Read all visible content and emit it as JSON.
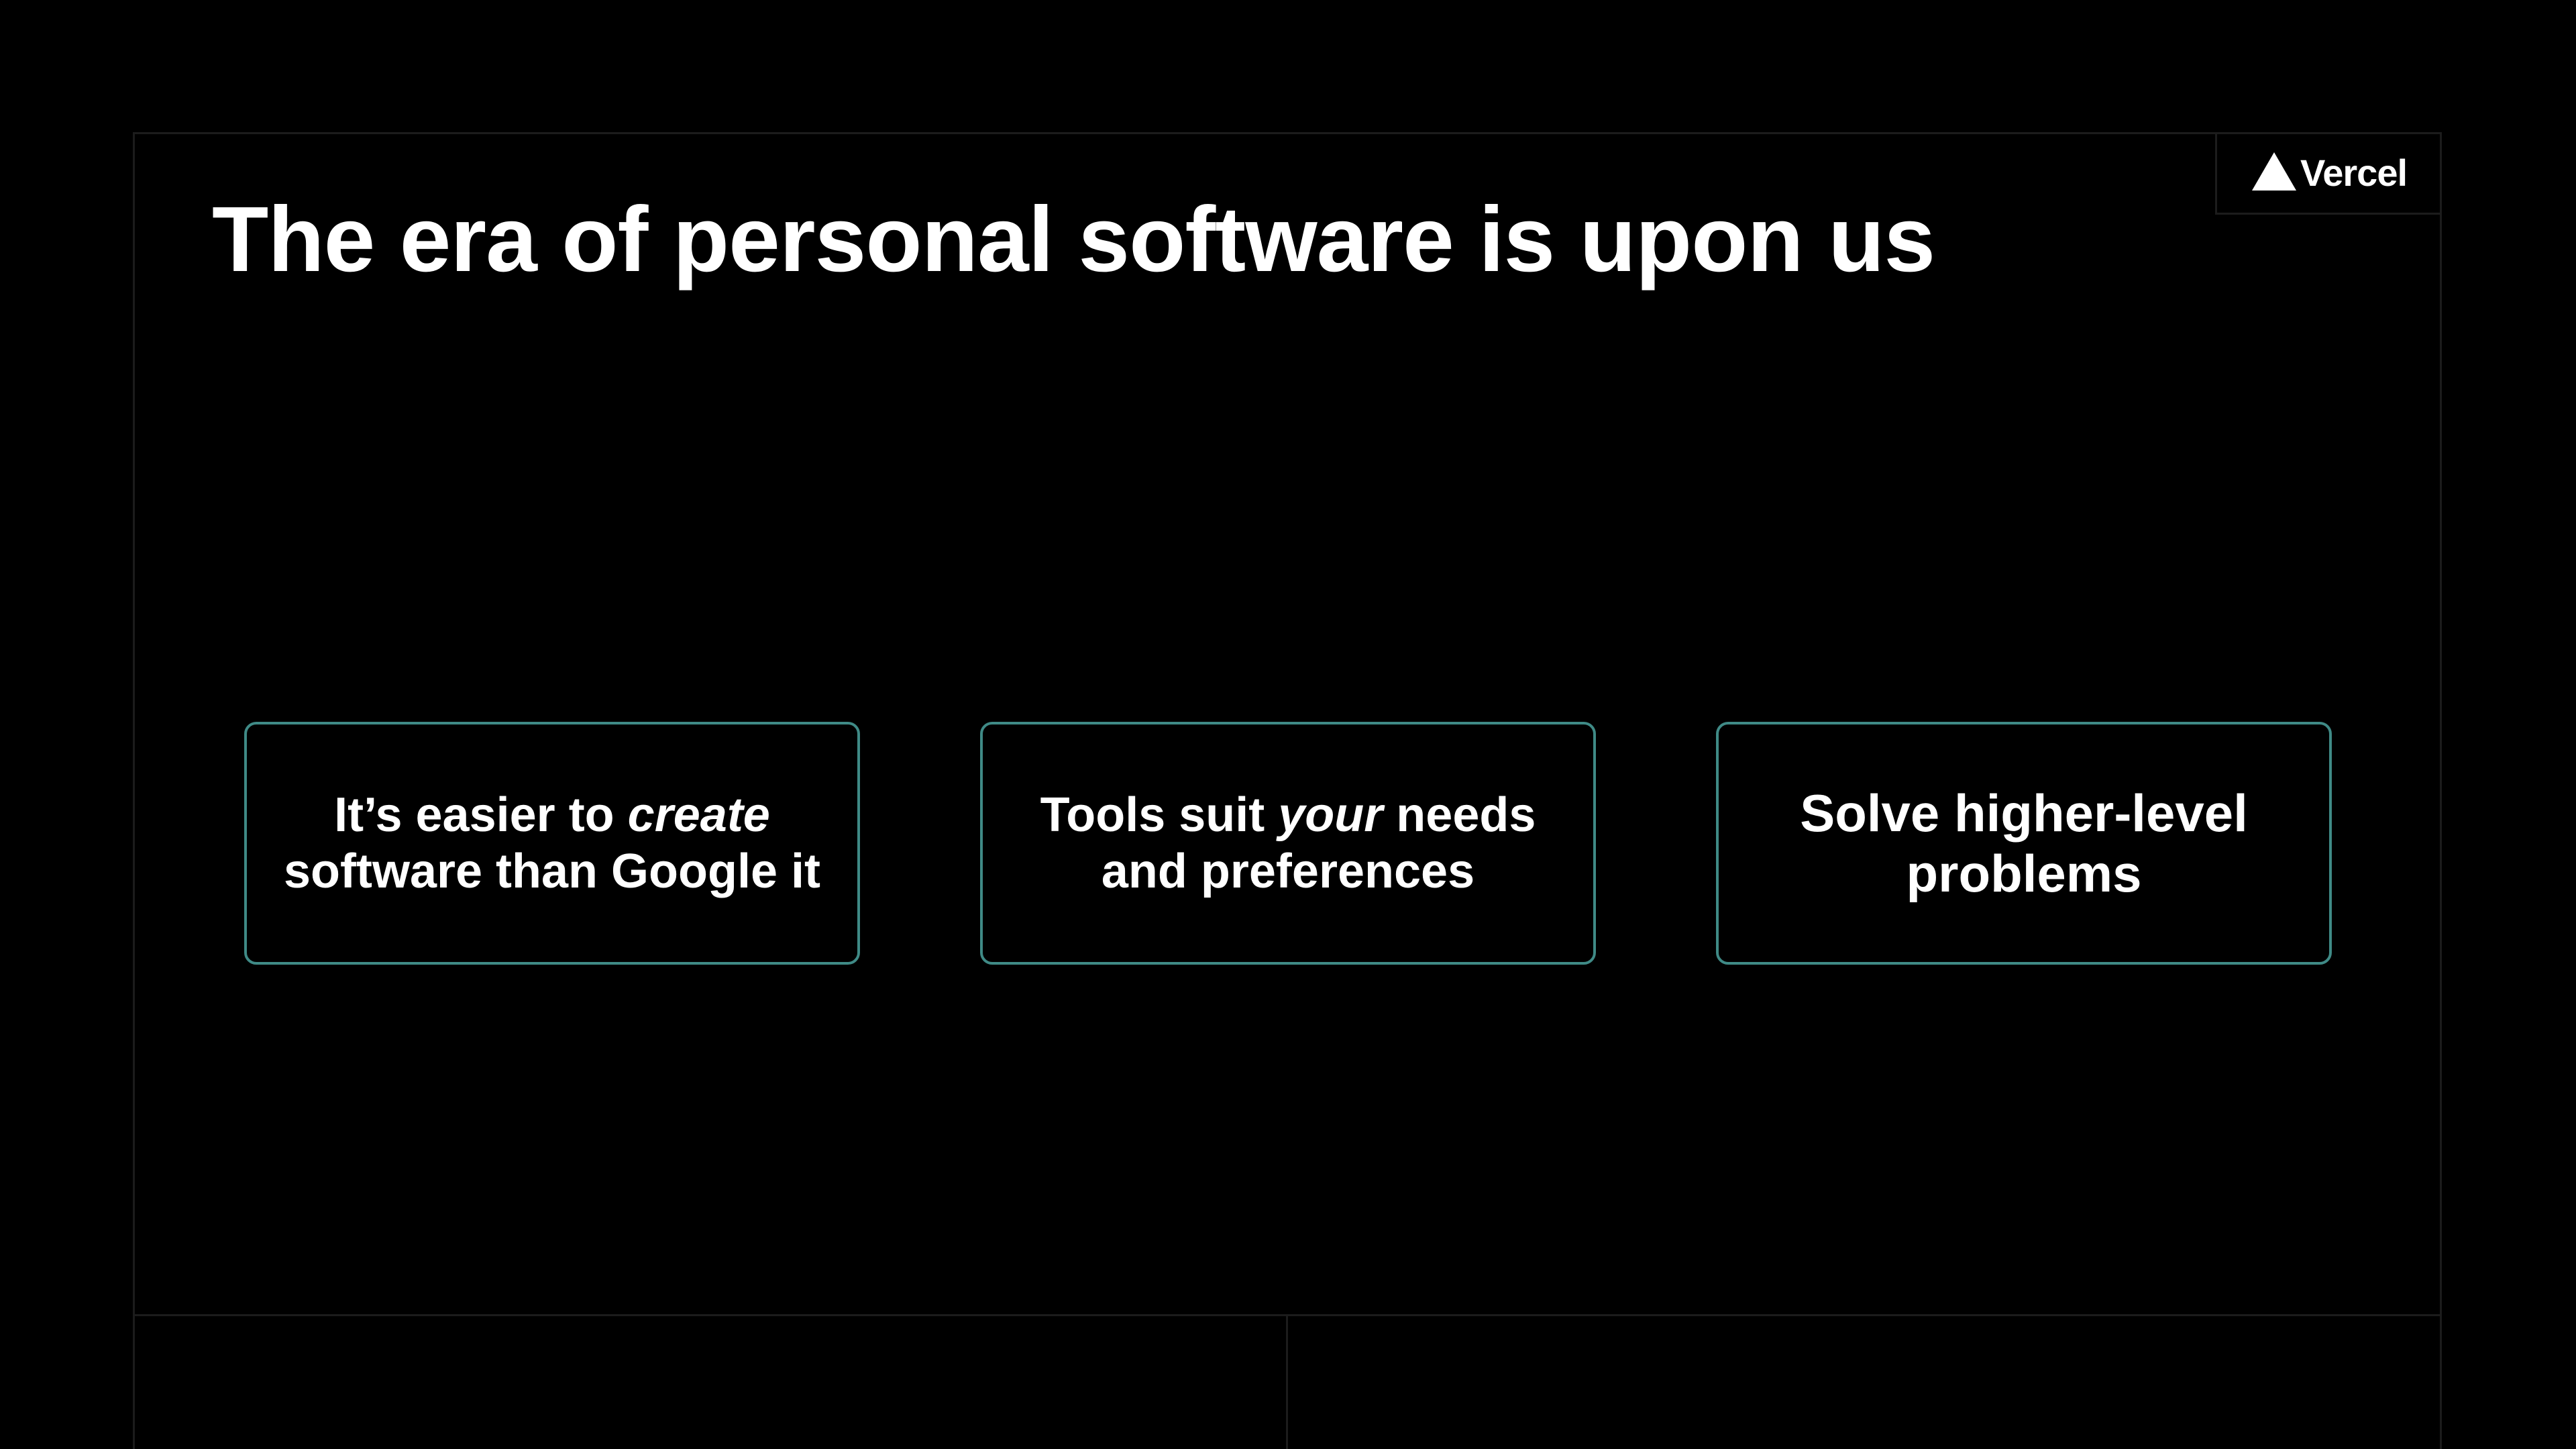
{
  "brand": {
    "name": "Vercel",
    "icon": "triangle-logo-icon"
  },
  "slide": {
    "title": "The era of personal software is upon us"
  },
  "cards": [
    {
      "line1_pre": "It’s easier to ",
      "line1_em": "create",
      "line1_post": "",
      "line2": "software than Google it"
    },
    {
      "line1_pre": "Tools suit ",
      "line1_em": "your",
      "line1_post": " needs",
      "line2": "and preferences"
    },
    {
      "line1": "Solve higher-level",
      "line2": "problems"
    }
  ],
  "colors": {
    "background": "#000000",
    "frame_border": "#1c1c1c",
    "card_border": "#3f8a86",
    "text": "#ffffff"
  }
}
